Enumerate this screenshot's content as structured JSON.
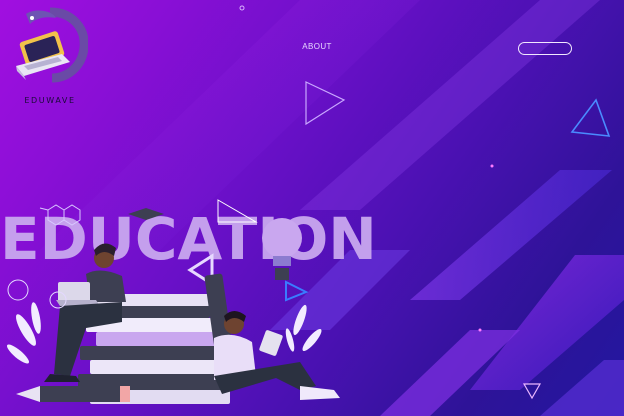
{
  "brand": {
    "name": "EDUWAVE"
  },
  "nav": {
    "about_label": "ABOUT"
  },
  "hero": {
    "title": "EDUCATION"
  },
  "colors": {
    "accent": "#a10fe0",
    "dark": "#2217a0",
    "text_light": "#e9d9ff",
    "title": "#c9a7ef"
  },
  "icons": {
    "logo": "laptop-logo-icon",
    "decor": [
      "triangle-outline-icon",
      "lightbulb-icon",
      "books-stack-icon",
      "pencil-icon"
    ]
  }
}
